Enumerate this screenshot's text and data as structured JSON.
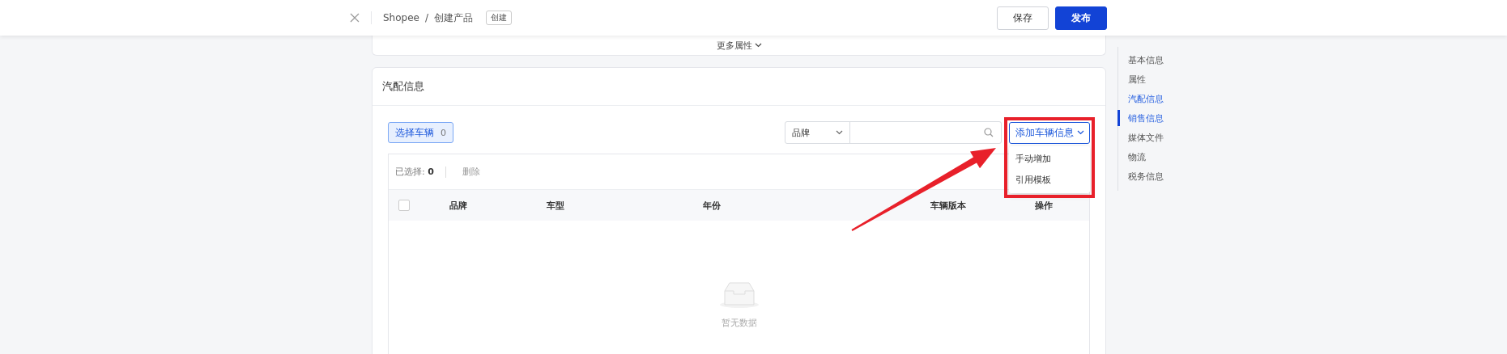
{
  "topbar": {
    "breadcrumb": [
      "Shopee",
      "创建产品"
    ],
    "separator": "/",
    "tag": "创建",
    "buttons": [
      {
        "label": "保存",
        "kind": "default"
      },
      {
        "label": "发布",
        "kind": "primary"
      }
    ]
  },
  "more_attributes": {
    "label": "更多属性"
  },
  "section": {
    "title": "汽配信息",
    "select_button": {
      "label": "选择车辆",
      "count": "0"
    },
    "filter": {
      "field": "品牌"
    },
    "add_button": {
      "label": "添加车辆信息",
      "expanded": true,
      "highlighted": true
    },
    "menu": [
      {
        "label": "手动增加"
      },
      {
        "label": "引用模板"
      }
    ],
    "table": {
      "selected_label": "已选择:",
      "selected_count": "0",
      "delete": "删除",
      "all_checked": false,
      "columns": [
        "品牌",
        "车型",
        "年份",
        "车辆版本",
        "操作"
      ],
      "empty_text": "暂无数据"
    }
  },
  "nav": [
    {
      "label": "基本信息",
      "selected": false,
      "hovered": false
    },
    {
      "label": "属性",
      "selected": false,
      "hovered": false
    },
    {
      "label": "汽配信息",
      "selected": false,
      "hovered": true
    },
    {
      "label": "销售信息",
      "selected": true,
      "hovered": false
    },
    {
      "label": "媒体文件",
      "selected": false,
      "hovered": false
    },
    {
      "label": "物流",
      "selected": false,
      "hovered": false
    },
    {
      "label": "税务信息",
      "selected": false,
      "hovered": false
    }
  ],
  "annotations": [
    {
      "kind": "arrow"
    }
  ]
}
